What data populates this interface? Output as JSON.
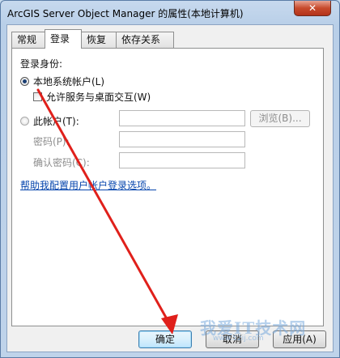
{
  "window": {
    "title": "ArcGIS Server Object Manager 的属性(本地计算机)",
    "close_label": "✕"
  },
  "tabs": [
    {
      "label": "常规",
      "active": false
    },
    {
      "label": "登录",
      "active": true
    },
    {
      "label": "恢复",
      "active": false
    },
    {
      "label": "依存关系",
      "active": false
    }
  ],
  "logon": {
    "section_label": "登录身份:",
    "local_system_label": "本地系统帐户(L)",
    "allow_desktop_label": "允许服务与桌面交互(W)",
    "this_account_label": "此帐户(T):",
    "browse_label": "浏览(B)...",
    "password_label": "密码(P):",
    "confirm_password_label": "确认密码(C):",
    "help_link": "帮助我配置用户帐户登录选项。"
  },
  "buttons": {
    "ok": "确定",
    "cancel": "取消",
    "apply": "应用(A)"
  },
  "watermark": {
    "text": "我爱IT技术网",
    "url": "www.52ij.com"
  },
  "annotation_color": "#e0201b"
}
